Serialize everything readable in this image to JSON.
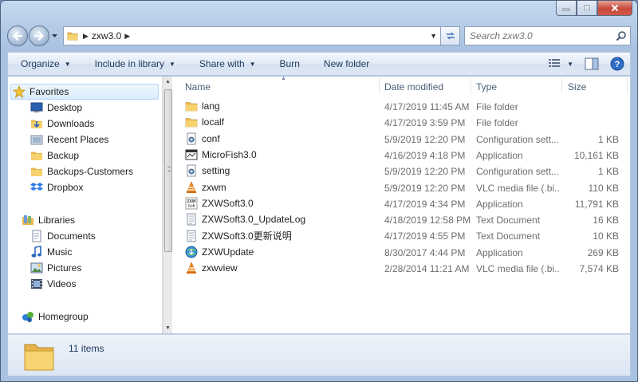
{
  "address": {
    "crumbs": [
      "zxw3.0"
    ],
    "search_placeholder": "Search zxw3.0"
  },
  "commands": {
    "organize": "Organize",
    "include_in_library": "Include in library",
    "share_with": "Share with",
    "burn": "Burn",
    "new_folder": "New folder"
  },
  "nav": {
    "favorites": {
      "label": "Favorites",
      "items": [
        "Desktop",
        "Downloads",
        "Recent Places",
        "Backup",
        "Backups-Customers",
        "Dropbox"
      ]
    },
    "libraries": {
      "label": "Libraries",
      "items": [
        "Documents",
        "Music",
        "Pictures",
        "Videos"
      ]
    },
    "homegroup": "Homegroup"
  },
  "columns": {
    "name": "Name",
    "date": "Date modified",
    "type": "Type",
    "size": "Size"
  },
  "files": [
    {
      "name": "lang",
      "date": "4/17/2019 11:45 AM",
      "type": "File folder",
      "size": "",
      "icon": "folder-icon"
    },
    {
      "name": "localf",
      "date": "4/17/2019 3:59 PM",
      "type": "File folder",
      "size": "",
      "icon": "folder-icon"
    },
    {
      "name": "conf",
      "date": "5/9/2019 12:20 PM",
      "type": "Configuration sett...",
      "size": "1 KB",
      "icon": "config-file-icon"
    },
    {
      "name": "MicroFish3.0",
      "date": "4/16/2019 4:18 PM",
      "type": "Application",
      "size": "10,161 KB",
      "icon": "app-window-icon"
    },
    {
      "name": "setting",
      "date": "5/9/2019 12:20 PM",
      "type": "Configuration sett...",
      "size": "1 KB",
      "icon": "config-file-icon"
    },
    {
      "name": "zxwm",
      "date": "5/9/2019 12:20 PM",
      "type": "VLC media file (.bi...",
      "size": "110 KB",
      "icon": "vlc-cone-icon"
    },
    {
      "name": "ZXWSoft3.0",
      "date": "4/17/2019 4:34 PM",
      "type": "Application",
      "size": "11,791 KB",
      "icon": "zxw-app-icon"
    },
    {
      "name": "ZXWSoft3.0_UpdateLog",
      "date": "4/18/2019 12:58 PM",
      "type": "Text Document",
      "size": "16 KB",
      "icon": "text-file-icon"
    },
    {
      "name": "ZXWSoft3.0更新说明",
      "date": "4/17/2019 4:55 PM",
      "type": "Text Document",
      "size": "10 KB",
      "icon": "text-file-icon"
    },
    {
      "name": "ZXWUpdate",
      "date": "8/30/2017 4:44 PM",
      "type": "Application",
      "size": "269 KB",
      "icon": "update-globe-icon"
    },
    {
      "name": "zxwview",
      "date": "2/28/2014 11:21 AM",
      "type": "VLC media file (.bi...",
      "size": "7,574 KB",
      "icon": "vlc-cone-icon"
    }
  ],
  "details": {
    "count": "11 items"
  }
}
